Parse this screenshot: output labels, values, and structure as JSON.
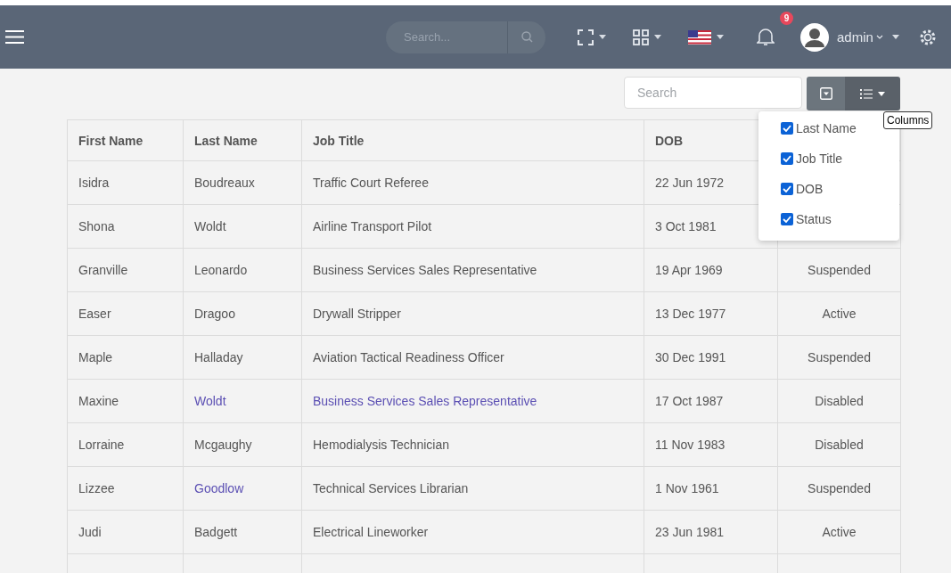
{
  "header": {
    "search": {
      "placeholder": "Search..."
    },
    "notifications": {
      "count": "9"
    },
    "user": {
      "name": "admin"
    }
  },
  "toolbar": {
    "search": {
      "placeholder": "Search"
    },
    "tooltip": "Columns"
  },
  "columns_menu": [
    {
      "label": "Last Name",
      "checked": true
    },
    {
      "label": "Job Title",
      "checked": true
    },
    {
      "label": "DOB",
      "checked": true
    },
    {
      "label": "Status",
      "checked": true
    }
  ],
  "table": {
    "columns": [
      {
        "label": "First Name"
      },
      {
        "label": "Last Name"
      },
      {
        "label": "Job Title"
      },
      {
        "label": "DOB"
      },
      {}
    ],
    "rows": [
      {
        "cells": [
          {
            "text": "Isidra",
            "link": false
          },
          {
            "text": "Boudreaux",
            "link": false
          },
          {
            "text": "Traffic Court Referee",
            "link": false
          },
          {
            "text": "22 Jun 1972",
            "link": false
          }
        ]
      },
      {
        "cells": [
          {
            "text": "Shona",
            "link": false
          },
          {
            "text": "Woldt",
            "link": false
          },
          {
            "text": "Airline Transport Pilot",
            "link": false
          },
          {
            "text": "3 Oct 1981",
            "link": false
          }
        ]
      },
      {
        "cells": [
          {
            "text": "Granville",
            "link": false
          },
          {
            "text": "Leonardo",
            "link": false
          },
          {
            "text": "Business Services Sales Representative",
            "link": false
          },
          {
            "text": "19 Apr 1969",
            "link": false
          },
          {
            "text": "Suspended",
            "link": false
          }
        ]
      },
      {
        "cells": [
          {
            "text": "Easer",
            "link": false
          },
          {
            "text": "Dragoo",
            "link": false
          },
          {
            "text": "Drywall Stripper",
            "link": false
          },
          {
            "text": "13 Dec 1977",
            "link": false
          },
          {
            "text": "Active",
            "link": false
          }
        ]
      },
      {
        "cells": [
          {
            "text": "Maple",
            "link": false
          },
          {
            "text": "Halladay",
            "link": false
          },
          {
            "text": "Aviation Tactical Readiness Officer",
            "link": false
          },
          {
            "text": "30 Dec 1991",
            "link": false
          },
          {
            "text": "Suspended",
            "link": false
          }
        ]
      },
      {
        "cells": [
          {
            "text": "Maxine",
            "link": false
          },
          {
            "text": "Woldt",
            "link": true
          },
          {
            "text": "Business Services Sales Representative",
            "link": true
          },
          {
            "text": "17 Oct 1987",
            "link": false
          },
          {
            "text": "Disabled",
            "link": false
          }
        ]
      },
      {
        "cells": [
          {
            "text": "Lorraine",
            "link": false
          },
          {
            "text": "Mcgaughy",
            "link": false
          },
          {
            "text": "Hemodialysis Technician",
            "link": false
          },
          {
            "text": "11 Nov 1983",
            "link": false
          },
          {
            "text": "Disabled",
            "link": false
          }
        ]
      },
      {
        "cells": [
          {
            "text": "Lizzee",
            "link": false
          },
          {
            "text": "Goodlow",
            "link": true
          },
          {
            "text": "Technical Services Librarian",
            "link": false
          },
          {
            "text": "1 Nov 1961",
            "link": false
          },
          {
            "text": "Suspended",
            "link": false
          }
        ]
      },
      {
        "cells": [
          {
            "text": "Judi",
            "link": false
          },
          {
            "text": "Badgett",
            "link": false
          },
          {
            "text": "Electrical Lineworker",
            "link": false
          },
          {
            "text": "23 Jun 1981",
            "link": false
          },
          {
            "text": "Active",
            "link": false
          }
        ]
      },
      {
        "cells": []
      }
    ]
  }
}
